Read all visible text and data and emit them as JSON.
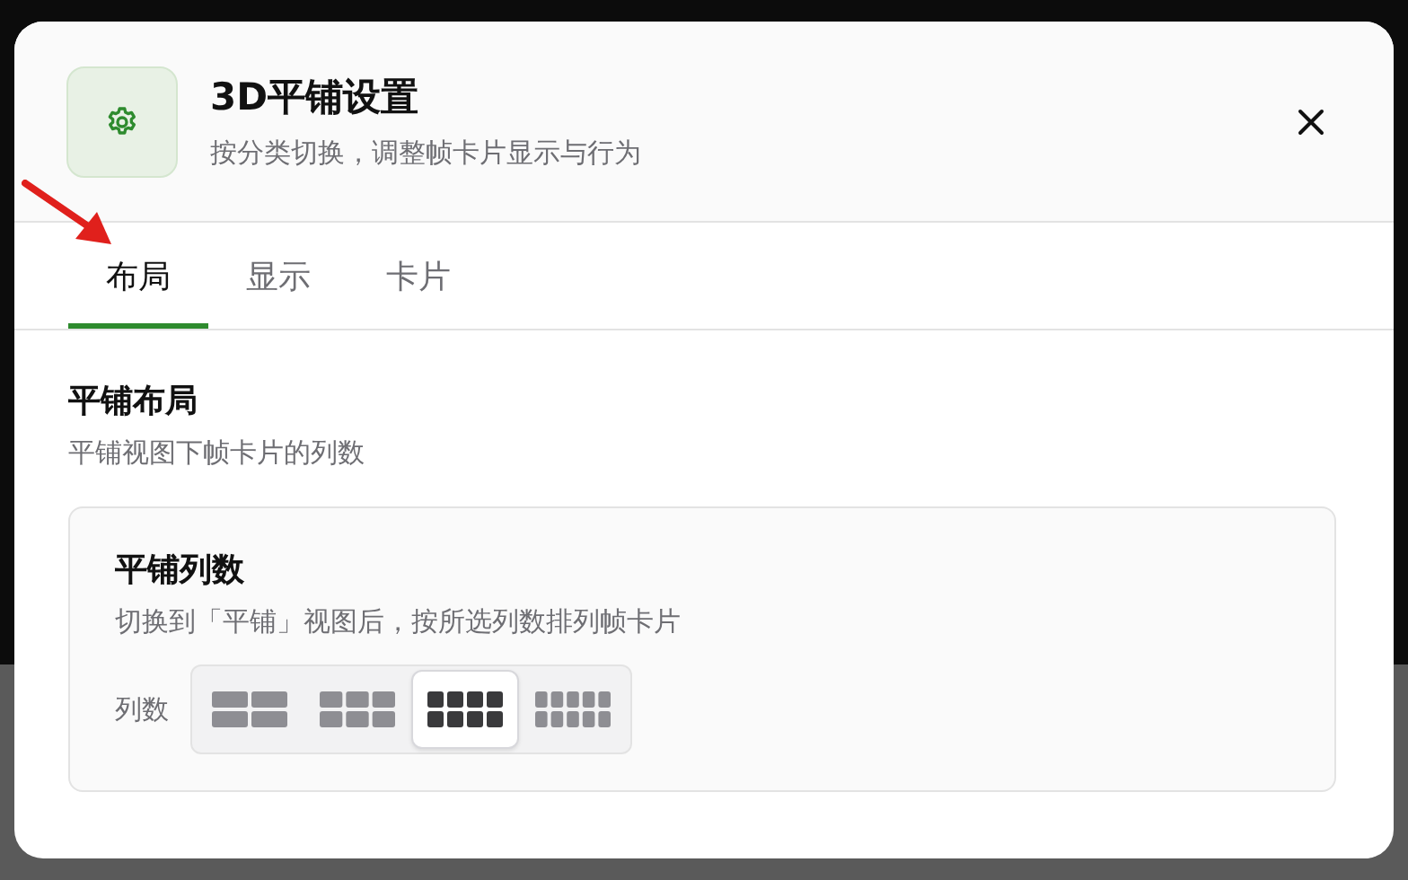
{
  "dialog": {
    "title": "3D平铺设置",
    "subtitle": "按分类切换，调整帧卡片显示与行为"
  },
  "tabs": [
    {
      "label": "布局",
      "selected": true
    },
    {
      "label": "显示",
      "selected": false
    },
    {
      "label": "卡片",
      "selected": false
    }
  ],
  "section": {
    "title": "平铺布局",
    "description": "平铺视图下帧卡片的列数"
  },
  "card": {
    "title": "平铺列数",
    "description": "切换到「平铺」视图后，按所选列数排列帧卡片",
    "field_label": "列数",
    "options": [
      {
        "kind": "two",
        "selected": false
      },
      {
        "kind": "three",
        "selected": false
      },
      {
        "kind": "four",
        "selected": true
      },
      {
        "kind": "five",
        "selected": false
      }
    ]
  }
}
